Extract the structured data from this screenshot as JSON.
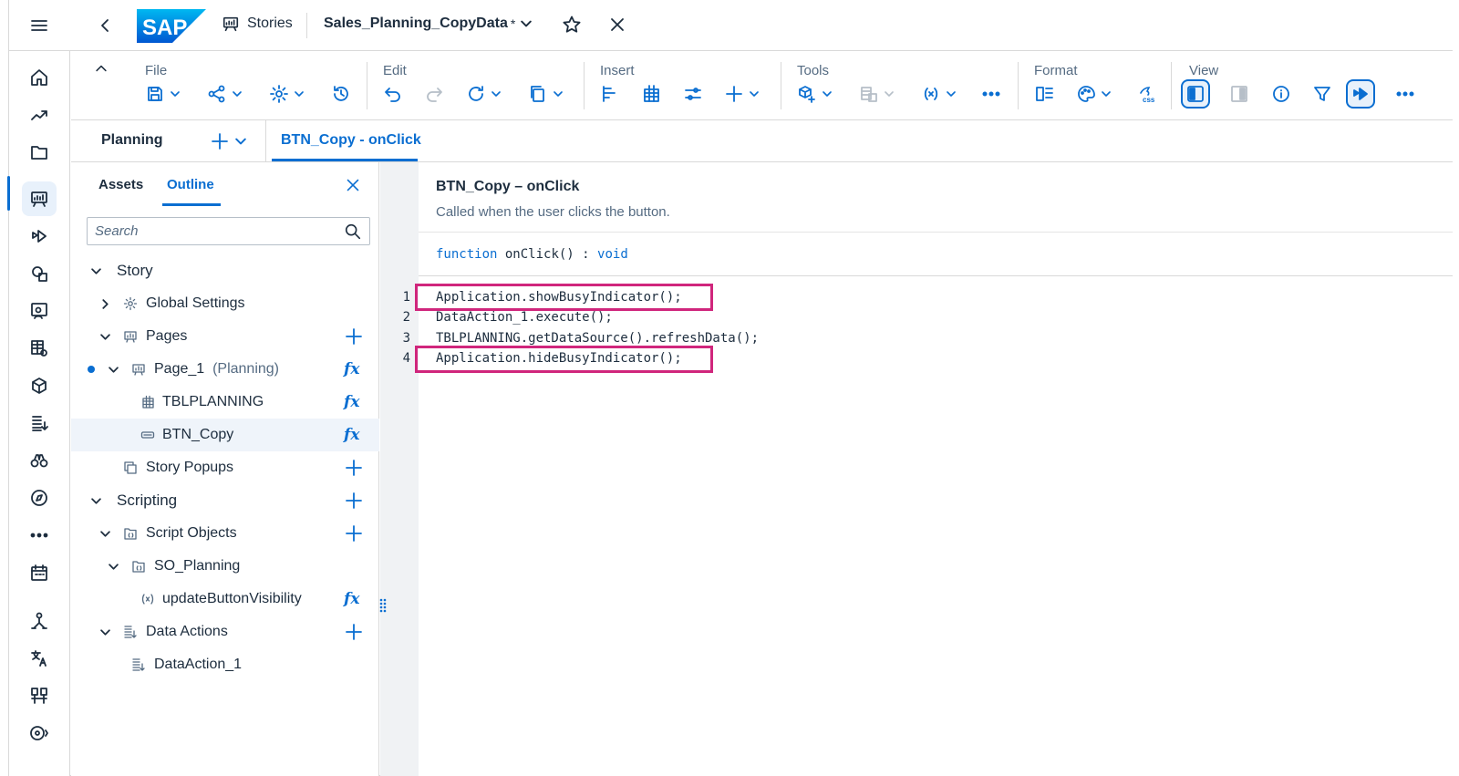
{
  "shell": {
    "logo_text": "SAP",
    "section": "Stories",
    "document_title": "Sales_Planning_CopyData",
    "modified_marker": "*"
  },
  "toolbar": {
    "groups": {
      "file": "File",
      "edit": "Edit",
      "insert": "Insert",
      "tools": "Tools",
      "format": "Format",
      "view": "View"
    },
    "css_label": "css"
  },
  "tabs": {
    "planning": "Planning",
    "script_tab": "BTN_Copy - onClick"
  },
  "panel": {
    "tab_assets": "Assets",
    "tab_outline": "Outline",
    "search_placeholder": "Search",
    "tree": {
      "story": "Story",
      "global_settings": "Global Settings",
      "pages": "Pages",
      "page1": "Page_1",
      "page1_sub": "(Planning)",
      "tblplanning": "TBLPLANNING",
      "btn_copy": "BTN_Copy",
      "story_popups": "Story Popups",
      "scripting": "Scripting",
      "script_objects": "Script Objects",
      "so_planning": "SO_Planning",
      "update_btn": "updateButtonVisibility",
      "data_actions": "Data Actions",
      "data_action_1": "DataAction_1"
    },
    "fx_label": "fx"
  },
  "editor": {
    "title": "BTN_Copy – onClick",
    "description": "Called when the user clicks the button.",
    "signature": {
      "kw1": "function",
      "name": "onClick()",
      "colon": ":",
      "ret": "void"
    },
    "lines": [
      {
        "num": "1",
        "code": "Application.showBusyIndicator();"
      },
      {
        "num": "2",
        "code": "DataAction_1.execute();"
      },
      {
        "num": "3",
        "code": "TBLPLANNING.getDataSource().refreshData();"
      },
      {
        "num": "4",
        "code": "Application.hideBusyIndicator();"
      }
    ]
  },
  "colors": {
    "accent": "#0a6ed1",
    "highlight": "#d0267c",
    "text": "#1d2d3e",
    "muted": "#556b82"
  }
}
